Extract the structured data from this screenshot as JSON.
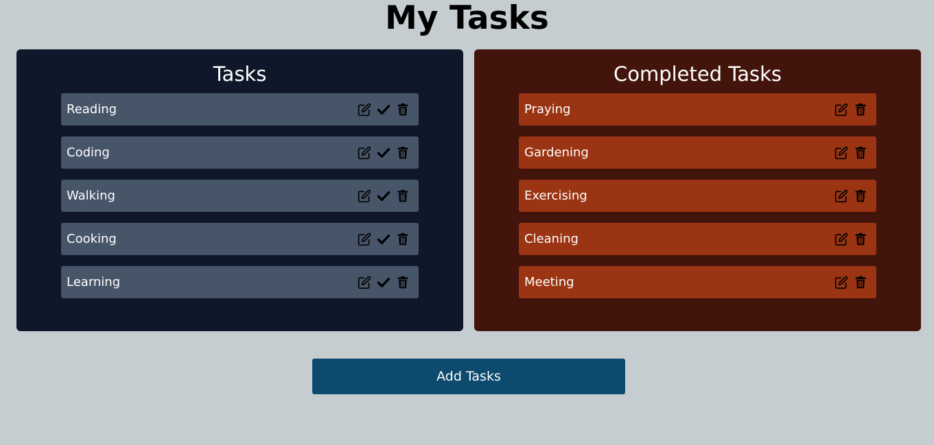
{
  "page": {
    "title": "My Tasks"
  },
  "todo": {
    "heading": "Tasks",
    "items": [
      {
        "label": "Reading"
      },
      {
        "label": "Coding"
      },
      {
        "label": "Walking"
      },
      {
        "label": "Cooking"
      },
      {
        "label": "Learning"
      }
    ],
    "actions": [
      "edit-icon",
      "check-icon",
      "trash-icon"
    ]
  },
  "done": {
    "heading": "Completed Tasks",
    "items": [
      {
        "label": "Praying"
      },
      {
        "label": "Gardening"
      },
      {
        "label": "Exercising"
      },
      {
        "label": "Cleaning"
      },
      {
        "label": "Meeting"
      }
    ],
    "actions": [
      "edit-icon",
      "trash-icon"
    ]
  },
  "footer": {
    "add_label": "Add Tasks"
  },
  "colors": {
    "background": "#c5cdd0",
    "todo_panel": "#0f172a",
    "todo_item": "#475569",
    "done_panel": "#42140b",
    "done_item": "#9a3412",
    "add_button": "#0c4a6e"
  }
}
